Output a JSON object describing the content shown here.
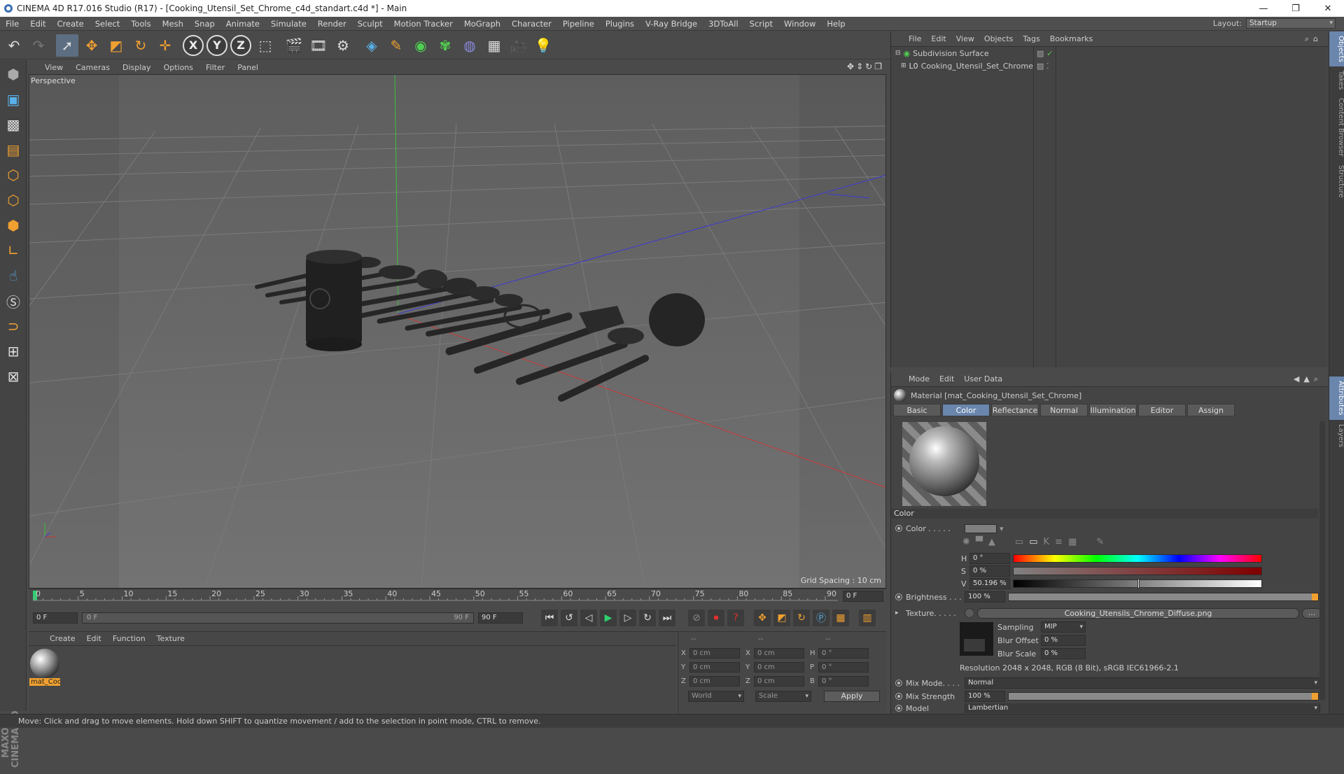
{
  "window": {
    "title": "CINEMA 4D R17.016 Studio (R17) - [Cooking_Utensil_Set_Chrome_c4d_standart.c4d *] - Main",
    "minimize": "—",
    "restore": "❐",
    "close": "✕"
  },
  "menubar": {
    "items": [
      "File",
      "Edit",
      "Create",
      "Select",
      "Tools",
      "Mesh",
      "Snap",
      "Animate",
      "Simulate",
      "Render",
      "Sculpt",
      "Motion Tracker",
      "MoGraph",
      "Character",
      "Pipeline",
      "Plugins",
      "V-Ray Bridge",
      "3DToAll",
      "Script",
      "Window",
      "Help"
    ],
    "layout_label": "Layout:",
    "layout_value": "Startup"
  },
  "toolbar": {
    "axes": [
      "X",
      "Y",
      "Z"
    ]
  },
  "viewport": {
    "menu": [
      "View",
      "Cameras",
      "Display",
      "Options",
      "Filter",
      "Panel"
    ],
    "label": "Perspective",
    "grid_spacing": "Grid Spacing : 10 cm"
  },
  "timeline": {
    "ticks": [
      "0",
      "5",
      "10",
      "15",
      "20",
      "25",
      "30",
      "35",
      "40",
      "45",
      "50",
      "55",
      "60",
      "65",
      "70",
      "75",
      "80",
      "85",
      "90"
    ],
    "current_frame": "0 F"
  },
  "playbar": {
    "start": "0 F",
    "range_start": "0 F",
    "range_end": "90 F",
    "end": "90 F"
  },
  "material_manager": {
    "menu": [
      "Create",
      "Edit",
      "Function",
      "Texture"
    ],
    "material_name": "mat_Coo"
  },
  "coordinates": {
    "headers": [
      "--",
      "--",
      "--"
    ],
    "rows": [
      {
        "a": "X",
        "av": "0 cm",
        "b": "X",
        "bv": "0 cm",
        "c": "H",
        "cv": "0 °"
      },
      {
        "a": "Y",
        "av": "0 cm",
        "b": "Y",
        "bv": "0 cm",
        "c": "P",
        "cv": "0 °"
      },
      {
        "a": "Z",
        "av": "0 cm",
        "b": "Z",
        "bv": "0 cm",
        "c": "B",
        "cv": "0 °"
      }
    ],
    "world": "World",
    "scale": "Scale",
    "apply": "Apply"
  },
  "objects_panel": {
    "menu": [
      "File",
      "Edit",
      "View",
      "Objects",
      "Tags",
      "Bookmarks"
    ],
    "items": [
      "Subdivision Surface",
      "Cooking_Utensil_Set_Chrome"
    ]
  },
  "attributes_panel": {
    "menu": [
      "Mode",
      "Edit",
      "User Data"
    ],
    "material_title": "Material [mat_Cooking_Utensil_Set_Chrome]",
    "tabs": [
      "Basic",
      "Color",
      "Reflectance",
      "Normal",
      "Illumination",
      "Editor",
      "Assign"
    ],
    "section": "Color",
    "color_label": "Color . . . . .",
    "h_label": "H",
    "h_value": "0 °",
    "s_label": "S",
    "s_value": "0 %",
    "v_label": "V",
    "v_value": "50.196 %",
    "brightness_label": "Brightness . . .",
    "brightness_value": "100 %",
    "texture_label": "Texture. . . . .",
    "texture_file": "Cooking_Utensils_Chrome_Diffuse.png",
    "sampling_label": "Sampling",
    "sampling_value": "MIP",
    "blur_offset_label": "Blur Offset",
    "blur_offset_value": "0 %",
    "blur_scale_label": "Blur Scale",
    "blur_scale_value": "0 %",
    "resolution": "Resolution 2048 x 2048, RGB (8 Bit), sRGB IEC61966-2.1",
    "mix_mode_label": "Mix Mode. . . .",
    "mix_mode_value": "Normal",
    "mix_strength_label": "Mix Strength",
    "mix_strength_value": "100 %",
    "model_label": "Model",
    "model_value": "Lambertian",
    "more": "..."
  },
  "side_tabs": [
    "Objects",
    "Takes",
    "Content Browser",
    "Structure",
    "Attributes",
    "Layers"
  ],
  "status": "Move: Click and drag to move elements. Hold down SHIFT to quantize movement / add to the selection in point mode, CTRL to remove.",
  "branding": {
    "logo": "MAXON CINEMA 4D"
  },
  "colors": {
    "accent": "#6a86ad",
    "viewport_bg": "#6b6b6b"
  }
}
